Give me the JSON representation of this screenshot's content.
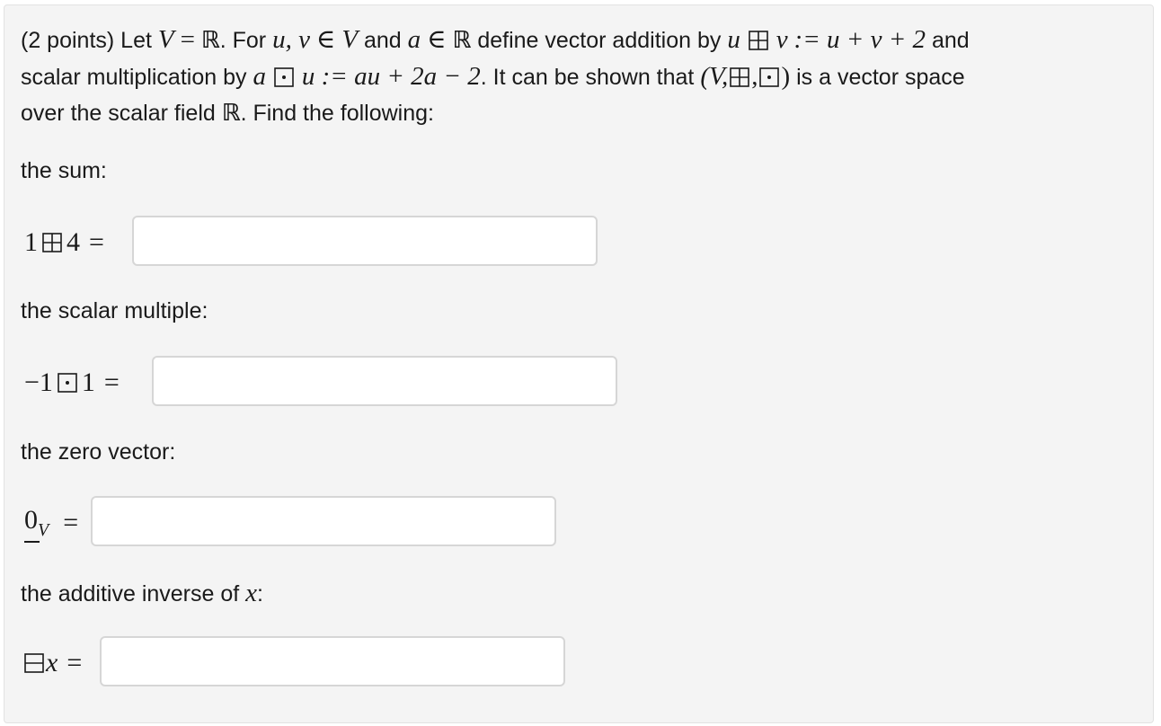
{
  "problem": {
    "points": "(2 points)",
    "t_let": "Let",
    "t_eq": "=",
    "t_for": ". For",
    "t_uv": "u, v",
    "t_in": "∈",
    "t_V": "V",
    "t_and": "and",
    "t_a": "a",
    "t_define": "define vector addition by",
    "t_u": "u",
    "t_v": "v",
    "t_defsum": ":= u + v + 2",
    "t_and2": "and",
    "t_scalar": "scalar multiplication by",
    "t_defmul": "u := au + 2a − 2",
    "t_shown": ". It can be shown that",
    "t_lparen": "(V,",
    "t_comma": ",",
    "t_rparen": ")",
    "t_isvs": "is a vector space",
    "t_over": "over the scalar field",
    "t_find": ". Find the following:",
    "real_symbol": "ℝ"
  },
  "parts": [
    {
      "label": "the sum:",
      "lhs_left": "1",
      "lhs_right": "4",
      "eq": "=",
      "value": ""
    },
    {
      "label": "the scalar multiple:",
      "lhs_left": "−1",
      "lhs_right": "1",
      "eq": "=",
      "value": ""
    },
    {
      "label": "the zero vector:",
      "lhs_zero": "0",
      "lhs_sub": "V",
      "eq": "=",
      "value": ""
    },
    {
      "label_text": "the additive inverse of",
      "label_var": "x",
      "label_colon": ":",
      "lhs_var": "x",
      "eq": "=",
      "value": ""
    }
  ]
}
